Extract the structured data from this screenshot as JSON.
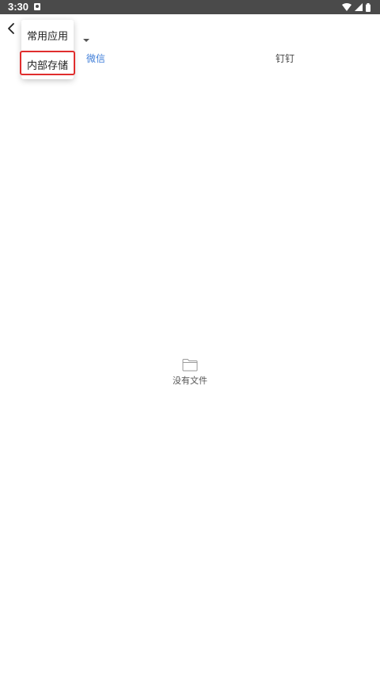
{
  "status_bar": {
    "time": "3:30",
    "icons": [
      "notification-icon",
      "wifi-icon",
      "signal-icon",
      "battery-icon"
    ]
  },
  "toolbar": {
    "back_icon": "chevron-left-icon",
    "dropdown_icon": "caret-down-icon"
  },
  "dropdown_menu": {
    "items": [
      {
        "label": "常用应用"
      },
      {
        "label": "内部存储",
        "highlighted": true
      }
    ]
  },
  "tabs": [
    {
      "label": "微信",
      "selected": true
    },
    {
      "label": "钉钉",
      "selected": false
    }
  ],
  "empty_state": {
    "icon": "folder-icon",
    "text": "没有文件"
  },
  "colors": {
    "status_bar": "#4a4a4a",
    "tab_selected": "#3f7ed8",
    "highlight": "#e02d2d"
  }
}
